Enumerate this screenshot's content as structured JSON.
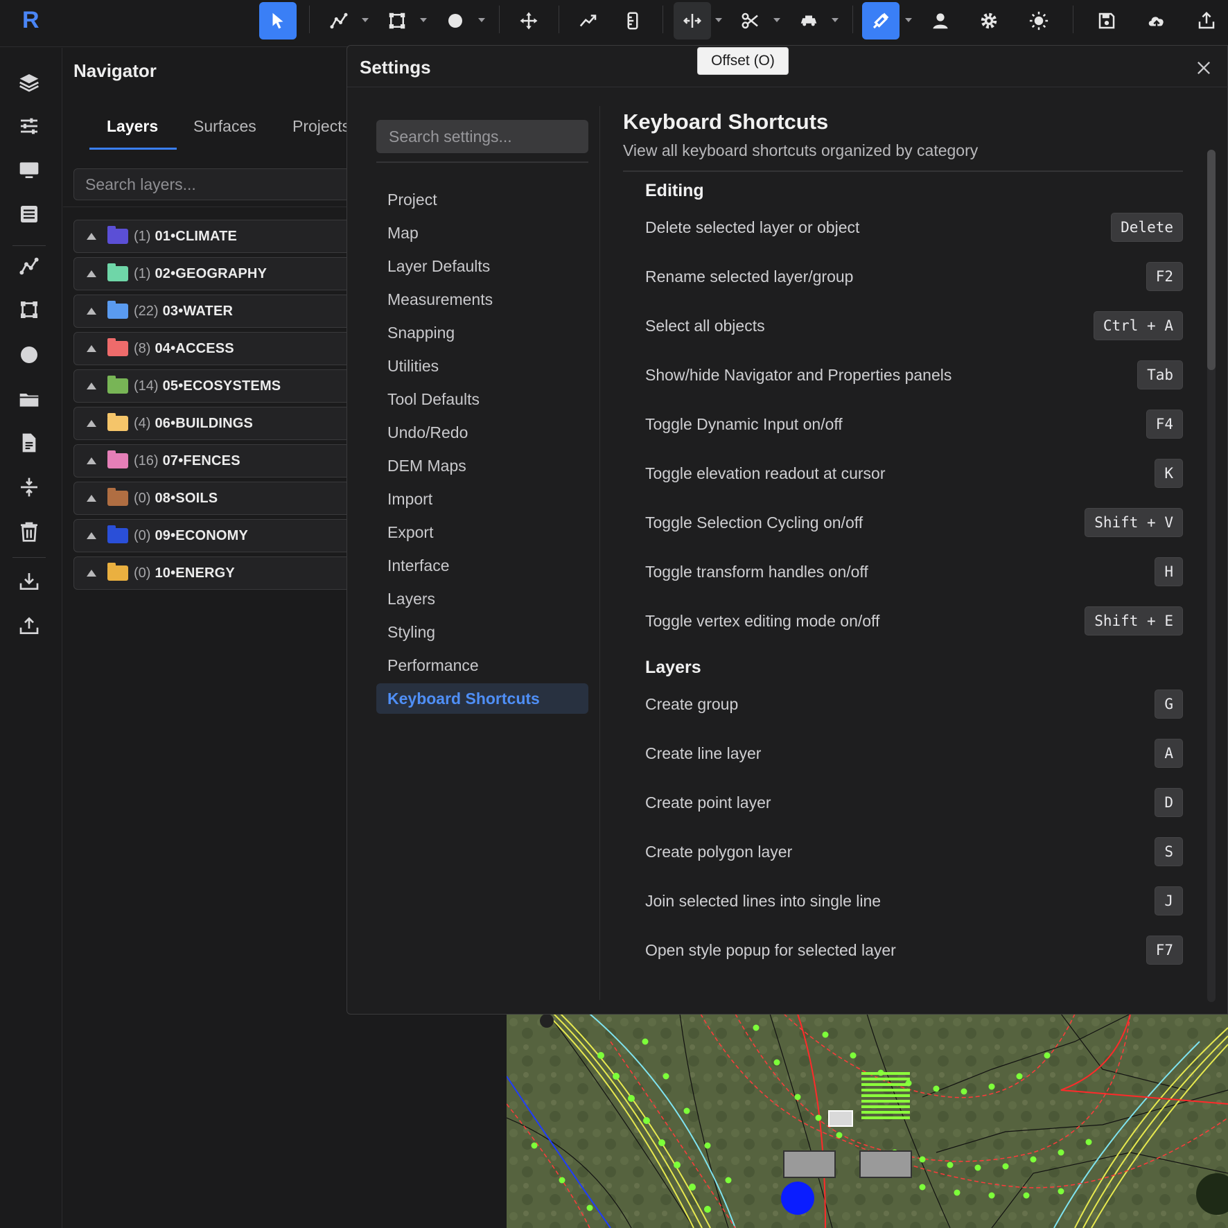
{
  "app": {
    "logo": "R",
    "accent": "#3a7ff6"
  },
  "toolbar": {
    "tooltip": "Offset (O)",
    "tools": [
      {
        "id": "select",
        "icon": "pointer-icon",
        "active": true
      },
      {
        "id": "draw-line",
        "icon": "polyline-icon",
        "dropdown": true
      },
      {
        "id": "draw-polygon",
        "icon": "polygon-icon",
        "dropdown": true
      },
      {
        "id": "draw-point",
        "icon": "circle-icon",
        "dropdown": true
      },
      {
        "id": "move",
        "icon": "move-icon"
      },
      {
        "id": "profile",
        "icon": "trend-icon"
      },
      {
        "id": "measure",
        "icon": "ruler-icon"
      },
      {
        "id": "offset",
        "icon": "offset-icon",
        "dropdown": true,
        "hover": true
      },
      {
        "id": "cut",
        "icon": "scissors-icon",
        "dropdown": true
      },
      {
        "id": "vehicle",
        "icon": "vehicle-icon",
        "dropdown": true
      },
      {
        "id": "snap",
        "icon": "magnet-icon",
        "dropdown": true,
        "active": true
      },
      {
        "id": "user",
        "icon": "user-icon"
      },
      {
        "id": "settings",
        "icon": "gear-icon"
      },
      {
        "id": "theme",
        "icon": "sun-icon"
      },
      {
        "id": "save",
        "icon": "save-icon"
      },
      {
        "id": "cloud",
        "icon": "cloud-upload-icon"
      },
      {
        "id": "share",
        "icon": "share-icon"
      }
    ]
  },
  "rail": [
    "layers-icon",
    "sliders-icon",
    "monitor-icon",
    "list-icon",
    "polyline-icon",
    "polygon-icon",
    "circle-icon",
    "folder-icon",
    "document-icon",
    "compress-icon",
    "trash-icon",
    "download-icon",
    "upload-icon"
  ],
  "navigator": {
    "title": "Navigator",
    "tabs": [
      "Layers",
      "Surfaces",
      "Projects"
    ],
    "active_tab": "Layers",
    "search_placeholder": "Search layers...",
    "layers": [
      {
        "count": "(1)",
        "name": "01•CLIMATE",
        "color": "#5b4fd6"
      },
      {
        "count": "(1)",
        "name": "02•GEOGRAPHY",
        "color": "#6fd6a8"
      },
      {
        "count": "(22)",
        "name": "03•WATER",
        "color": "#5a9bf0"
      },
      {
        "count": "(8)",
        "name": "04•ACCESS",
        "color": "#ee6b6b"
      },
      {
        "count": "(14)",
        "name": "05•ECOSYSTEMS",
        "color": "#78b556"
      },
      {
        "count": "(4)",
        "name": "06•BUILDINGS",
        "color": "#f5c56a"
      },
      {
        "count": "(16)",
        "name": "07•FENCES",
        "color": "#e57fb8"
      },
      {
        "count": "(0)",
        "name": "08•SOILS",
        "color": "#b06e42"
      },
      {
        "count": "(0)",
        "name": "09•ECONOMY",
        "color": "#2a4fd8"
      },
      {
        "count": "(0)",
        "name": "10•ENERGY",
        "color": "#eab040"
      }
    ]
  },
  "settings": {
    "title": "Settings",
    "search_placeholder": "Search settings...",
    "menu": [
      "Project",
      "Map",
      "Layer Defaults",
      "Measurements",
      "Snapping",
      "Utilities",
      "Tool Defaults",
      "Undo/Redo",
      "DEM Maps",
      "Import",
      "Export",
      "Interface",
      "Layers",
      "Styling",
      "Performance",
      "Keyboard Shortcuts"
    ],
    "active_menu": "Keyboard Shortcuts",
    "content": {
      "title": "Keyboard Shortcuts",
      "subtitle": "View all keyboard shortcuts organized by category",
      "categories": [
        {
          "name": "Editing",
          "shortcuts": [
            {
              "label": "Delete selected layer or object",
              "key": "Delete"
            },
            {
              "label": "Rename selected layer/group",
              "key": "F2"
            },
            {
              "label": "Select all objects",
              "key": "Ctrl + A"
            },
            {
              "label": "Show/hide Navigator and Properties panels",
              "key": "Tab"
            },
            {
              "label": "Toggle Dynamic Input on/off",
              "key": "F4"
            },
            {
              "label": "Toggle elevation readout at cursor",
              "key": "K"
            },
            {
              "label": "Toggle Selection Cycling on/off",
              "key": "Shift + V"
            },
            {
              "label": "Toggle transform handles on/off",
              "key": "H"
            },
            {
              "label": "Toggle vertex editing mode on/off",
              "key": "Shift + E"
            }
          ]
        },
        {
          "name": "Layers",
          "shortcuts": [
            {
              "label": "Create group",
              "key": "G"
            },
            {
              "label": "Create line layer",
              "key": "A"
            },
            {
              "label": "Create point layer",
              "key": "D"
            },
            {
              "label": "Create polygon layer",
              "key": "S"
            },
            {
              "label": "Join selected lines into single line",
              "key": "J"
            },
            {
              "label": "Open style popup for selected layer",
              "key": "F7"
            }
          ]
        }
      ]
    }
  }
}
